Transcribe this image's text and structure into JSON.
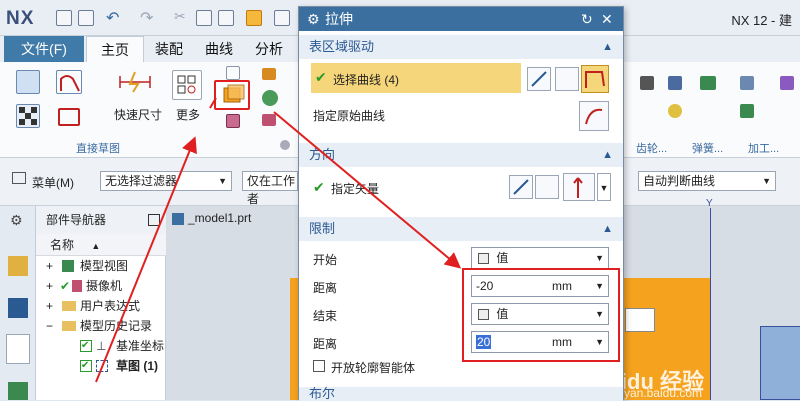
{
  "app": {
    "logo": "NX",
    "title": "NX 12 - 建"
  },
  "menu": {
    "file": "文件(F)",
    "tabs": [
      "主页",
      "装配",
      "曲线",
      "分析"
    ]
  },
  "ribbon": {
    "quick_dim": "快速尺寸",
    "more": "更多",
    "group_direct_sketch": "直接草图",
    "group_gear": "齿轮...",
    "group_spring": "弹簧...",
    "group_machining": "加工..."
  },
  "toolbar": {
    "menu": "菜单(M)",
    "filter": "无选择过滤器",
    "scope": "仅在工作者",
    "curve_rule": "自动判断曲线"
  },
  "navigator": {
    "title": "部件导航器",
    "col_name": "名称",
    "items": [
      "模型视图",
      "摄像机",
      "用户表达式",
      "模型历史记录",
      "基准坐标",
      "草图 (1)"
    ]
  },
  "graphics": {
    "tab": "_model1.prt"
  },
  "dialog": {
    "title": "拉伸",
    "sec_section": "表区域驱动",
    "select_curve": "选择曲线 (4)",
    "specify_origin": "指定原始曲线",
    "sec_direction": "方向",
    "specify_vector": "指定矢量",
    "sec_limits": "限制",
    "start_label": "开始",
    "start_value": "值",
    "distance_label": "距离",
    "start_distance": "-20",
    "unit": "mm",
    "end_label": "结束",
    "end_value": "值",
    "end_distance": "20",
    "open_profile": "开放轮廓智能体",
    "sec_bool": "布尔"
  },
  "watermark": {
    "brand": "Baidu 经验",
    "url": "jingyan.baidu.com"
  },
  "colors": {
    "accent": "#3a6fa0",
    "highlight": "#f6d67a",
    "annotation": "#e02020",
    "body": "#f5a21e"
  }
}
